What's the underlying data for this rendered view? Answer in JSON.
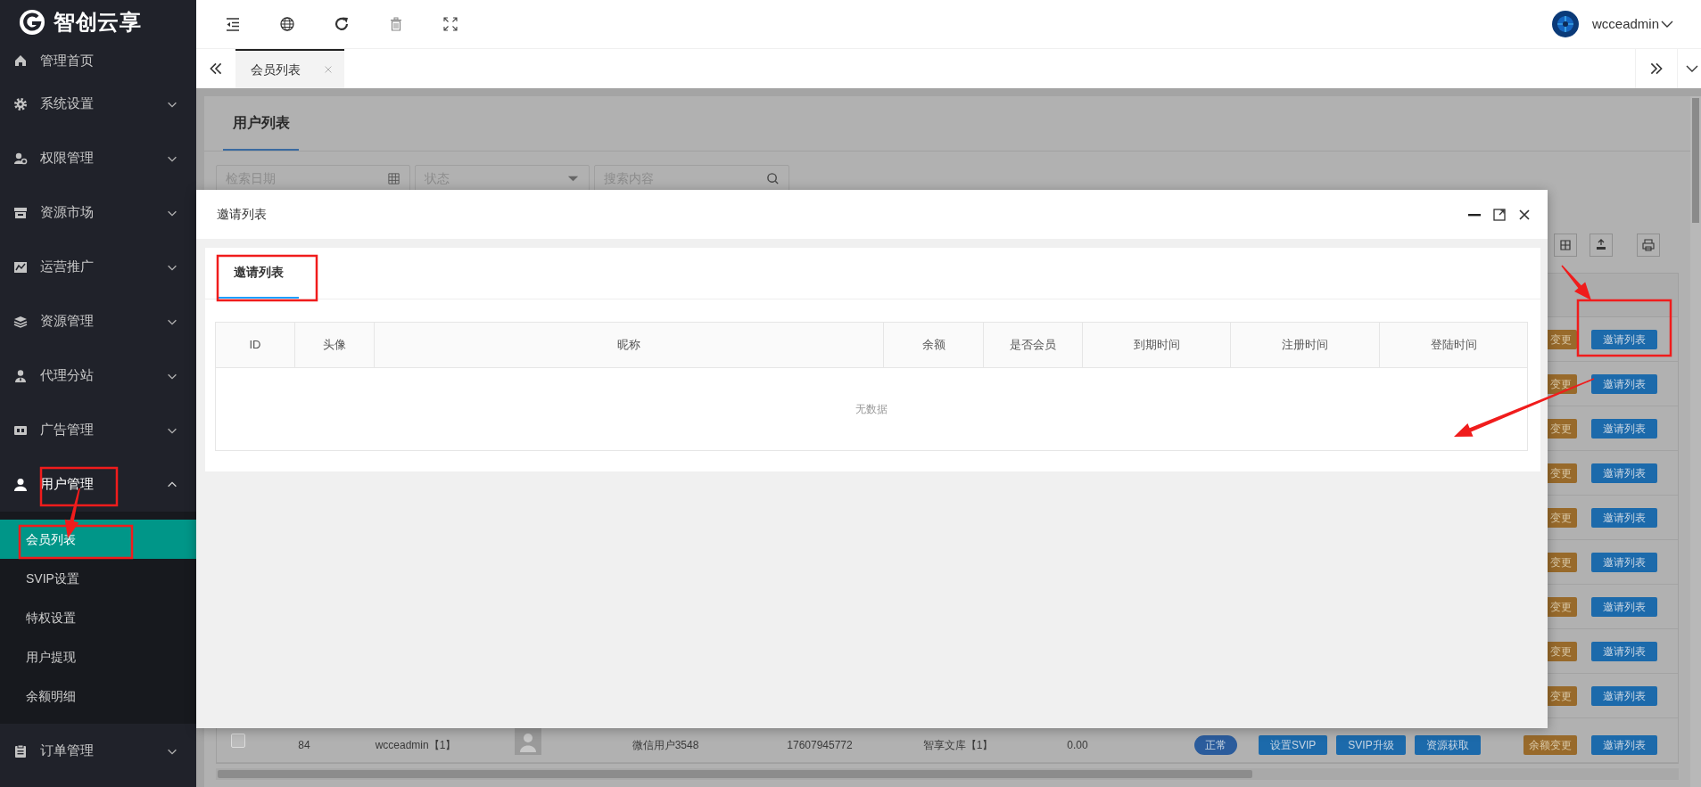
{
  "sidebar": {
    "logo": "智创云享",
    "items": [
      {
        "label": "管理首页"
      },
      {
        "label": "系统设置",
        "expanded": false
      },
      {
        "label": "权限管理",
        "expanded": false
      },
      {
        "label": "资源市场",
        "expanded": false
      },
      {
        "label": "运营推广",
        "expanded": false
      },
      {
        "label": "资源管理",
        "expanded": false
      },
      {
        "label": "代理分站",
        "expanded": false
      },
      {
        "label": "广告管理",
        "expanded": false
      },
      {
        "label": "用户管理",
        "expanded": true,
        "children": [
          {
            "label": "会员列表",
            "selected": true
          },
          {
            "label": "SVIP设置",
            "selected": false
          },
          {
            "label": "特权设置",
            "selected": false
          },
          {
            "label": "用户提现",
            "selected": false
          },
          {
            "label": "余额明细",
            "selected": false
          }
        ]
      },
      {
        "label": "订单管理",
        "expanded": false
      }
    ]
  },
  "topbar": {
    "user": "wcceadmin"
  },
  "tabs": [
    {
      "label": "会员列表",
      "selected": true
    }
  ],
  "page": {
    "tab": "用户列表",
    "filters": [
      {
        "placeholder": "检索日期",
        "kind": "date"
      },
      {
        "placeholder": "状态",
        "kind": "select"
      },
      {
        "placeholder": "搜索内容",
        "kind": "search"
      }
    ],
    "rows": [
      {
        "actions": [
          {
            "label": "变更",
            "kind": "warning"
          },
          {
            "label": "邀请列表",
            "kind": "primary"
          }
        ]
      },
      {
        "actions": [
          {
            "label": "变更",
            "kind": "warning"
          },
          {
            "label": "邀请列表",
            "kind": "primary"
          }
        ]
      },
      {
        "actions": [
          {
            "label": "变更",
            "kind": "warning"
          },
          {
            "label": "邀请列表",
            "kind": "primary"
          }
        ]
      },
      {
        "actions": [
          {
            "label": "变更",
            "kind": "warning"
          },
          {
            "label": "邀请列表",
            "kind": "primary"
          }
        ]
      },
      {
        "actions": [
          {
            "label": "变更",
            "kind": "warning"
          },
          {
            "label": "邀请列表",
            "kind": "primary"
          }
        ]
      },
      {
        "actions": [
          {
            "label": "变更",
            "kind": "warning"
          },
          {
            "label": "邀请列表",
            "kind": "primary"
          }
        ]
      },
      {
        "actions": [
          {
            "label": "变更",
            "kind": "warning"
          },
          {
            "label": "邀请列表",
            "kind": "primary"
          }
        ]
      },
      {
        "actions": [
          {
            "label": "变更",
            "kind": "warning"
          },
          {
            "label": "邀请列表",
            "kind": "primary"
          }
        ]
      },
      {
        "actions": [
          {
            "label": "变更",
            "kind": "warning"
          },
          {
            "label": "邀请列表",
            "kind": "primary"
          }
        ]
      },
      {
        "checked": false,
        "cells": [
          {
            "kind": "text",
            "text": "84"
          },
          {
            "kind": "text",
            "text": "wcceadmin【1】"
          },
          {
            "kind": "avatar"
          },
          {
            "kind": "text",
            "text": "微信用户3548"
          },
          {
            "kind": "text",
            "text": "17607945772"
          },
          {
            "kind": "text",
            "text": "智享文库【1】"
          },
          {
            "kind": "text",
            "text": "0.00"
          }
        ],
        "status": "正常",
        "buttons": [
          {
            "label": "设置SVIP",
            "kind": "primary"
          },
          {
            "label": "SVIP升级",
            "kind": "primary"
          },
          {
            "label": "资源获取",
            "kind": "primary"
          }
        ],
        "actions": [
          {
            "label": "余额变更",
            "kind": "warning"
          },
          {
            "label": "邀请列表",
            "kind": "primary"
          }
        ]
      }
    ]
  },
  "modal": {
    "title": "邀请列表",
    "tab": "邀请列表",
    "columns": [
      "ID",
      "头像",
      "昵称",
      "余额",
      "是否会员",
      "到期时间",
      "注册时间",
      "登陆时间"
    ],
    "empty_text": "无数据"
  }
}
